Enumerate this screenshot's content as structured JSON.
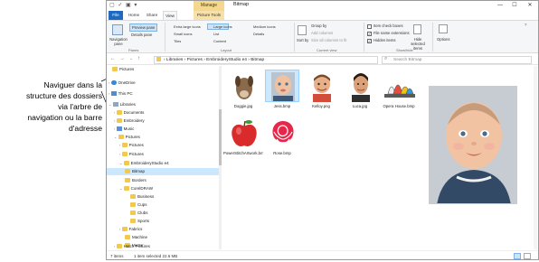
{
  "callout": {
    "lines": [
      "Naviguer dans la",
      "structure des dossiers",
      "via l'arbre de",
      "navigation ou la barre",
      "d'adresse"
    ]
  },
  "window": {
    "title": "Bitmap",
    "context_tab": "Manage",
    "controls": [
      "—",
      "☐",
      "✕"
    ]
  },
  "tabs": [
    "File",
    "Home",
    "Share",
    "View",
    "Picture Tools"
  ],
  "ribbon": {
    "panes": {
      "nav_pane": "Navigation pane",
      "preview_pane": "Preview pane",
      "details_pane": "Details pane",
      "group": "Panes"
    },
    "layout": {
      "items": [
        "Extra large icons",
        "Large icons",
        "Medium icons",
        "Small icons",
        "List",
        "Details",
        "Tiles",
        "Content"
      ],
      "group": "Layout"
    },
    "current_view": {
      "sort_by": "Sort by",
      "group_by": "Group by",
      "add_columns": "Add columns",
      "size_all_columns": "Size all columns to fit",
      "group": "Current view"
    },
    "show_hide": {
      "item_check_boxes": "Item check boxes",
      "file_name_extensions": "File name extensions",
      "hidden_items": "Hidden items",
      "hide_selected": "Hide selected items",
      "group": "Show/hide"
    },
    "options": "Options"
  },
  "address": {
    "path": "›  Libraries  ›  Pictures  ›  EmbroideryStudio e4  ›  Bitmap",
    "search_placeholder": "Search Bitmap"
  },
  "nav_items": [
    {
      "label": "Pictures",
      "level": 1,
      "icon": "folder",
      "selected": false
    },
    {
      "label": "OneDrive",
      "level": 0,
      "icon": "cloud",
      "selected": false
    },
    {
      "label": "This PC",
      "level": 0,
      "icon": "pc",
      "selected": false
    },
    {
      "label": "Libraries",
      "level": 0,
      "icon": "library",
      "selected": false
    },
    {
      "label": "Documents",
      "level": 1,
      "icon": "folder",
      "selected": false
    },
    {
      "label": "Embroidery",
      "level": 1,
      "icon": "folder",
      "selected": false
    },
    {
      "label": "Music",
      "level": 1,
      "icon": "folder",
      "selected": false
    },
    {
      "label": "Pictures",
      "level": 1,
      "icon": "folder",
      "selected": false
    },
    {
      "label": "Pictures",
      "level": 2,
      "icon": "folder",
      "selected": false
    },
    {
      "label": "Pictures",
      "level": 2,
      "icon": "folder",
      "selected": false
    },
    {
      "label": "EmbroideryStudio e4",
      "level": 2,
      "icon": "folder",
      "selected": false
    },
    {
      "label": "Bitmap",
      "level": 3,
      "icon": "folder",
      "selected": true
    },
    {
      "label": "Borders",
      "level": 3,
      "icon": "folder",
      "selected": false
    },
    {
      "label": "CorelDRAW",
      "level": 3,
      "icon": "folder",
      "selected": false
    },
    {
      "label": "Business",
      "level": 4,
      "icon": "folder",
      "selected": false
    },
    {
      "label": "Cups",
      "level": 4,
      "icon": "folder",
      "selected": false
    },
    {
      "label": "Clubs",
      "level": 4,
      "icon": "folder",
      "selected": false
    },
    {
      "label": "Sports",
      "level": 4,
      "icon": "folder",
      "selected": false
    },
    {
      "label": "Fabrics",
      "level": 3,
      "icon": "folder",
      "selected": false
    },
    {
      "label": "Machine",
      "level": 3,
      "icon": "folder",
      "selected": false
    },
    {
      "label": "Vector",
      "level": 3,
      "icon": "folder",
      "selected": false
    },
    {
      "label": "Hatch Pictures",
      "level": 2,
      "icon": "folder",
      "selected": false
    }
  ],
  "files": [
    {
      "name": "Doggie.jpg",
      "kind": "dog",
      "selected": false
    },
    {
      "name": "Jess.bmp",
      "kind": "baby",
      "selected": true
    },
    {
      "name": "Kelloy.png",
      "kind": "boy",
      "selected": false
    },
    {
      "name": "Luca.jpg",
      "kind": "man",
      "selected": false
    },
    {
      "name": "Opera House.bmp",
      "kind": "opera",
      "selected": false
    },
    {
      "name": "PowerStitchArtwork.bmp",
      "kind": "apple",
      "selected": false
    },
    {
      "name": "Rose.bmp",
      "kind": "rose",
      "selected": false
    }
  ],
  "status": {
    "count": "7 items",
    "selection": "1 item selected  22.6 MB"
  }
}
